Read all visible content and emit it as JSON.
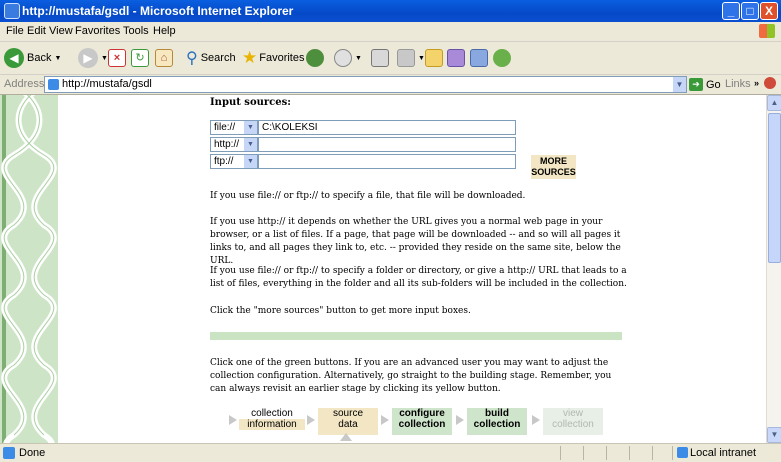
{
  "window": {
    "title": "http://mustafa/gsdl - Microsoft Internet Explorer",
    "controls": {
      "minimize": "_",
      "maximize": "□",
      "close": "X"
    }
  },
  "menu": [
    "File",
    "Edit",
    "View",
    "Favorites",
    "Tools",
    "Help"
  ],
  "toolbar": {
    "back": "Back",
    "search": "Search",
    "favorites": "Favorites"
  },
  "address": {
    "label": "Address",
    "url": "http://mustafa/gsdl",
    "go": "Go",
    "links": "Links"
  },
  "page": {
    "heading": "Input sources:",
    "sources": [
      {
        "protocol": "file://",
        "value": "C:\\KOLEKSI"
      },
      {
        "protocol": "http://",
        "value": ""
      },
      {
        "protocol": "ftp://",
        "value": ""
      }
    ],
    "more_sources": {
      "line1": "MORE",
      "line2": "SOURCES"
    },
    "paragraphs": [
      "If you use file:// or ftp:// to specify a file, that file will be downloaded.",
      "If you use http:// it depends on whether the URL gives you a normal web page in your browser, or a list of files. If a page, that page will be downloaded -- and so will all pages it links to, and all pages they link to, etc. -- provided they reside on the same site, below the URL.",
      "If you use file:// or ftp:// to specify a folder or directory, or give a http:// URL that leads to a list of files, everything in the folder and all its sub-folders will be included in the collection.",
      "Click the \"more sources\" button to get more input boxes."
    ],
    "instructions": "Click one of the green buttons. If you are an advanced user you may want to adjust the collection configuration. Alternatively, go straight to the building stage. Remember, you can always revisit an earlier stage by clicking its yellow button.",
    "stages": [
      {
        "line1": "collection",
        "line2": "information",
        "state": "visited"
      },
      {
        "line1": "source",
        "line2": "data",
        "state": "current"
      },
      {
        "line1": "configure",
        "line2": "collection",
        "state": "available"
      },
      {
        "line1": "build",
        "line2": "collection",
        "state": "available"
      },
      {
        "line1": "view",
        "line2": "collection",
        "state": "disabled"
      }
    ],
    "colors": {
      "visited": "#f2e6c4",
      "current": "#f2e6c4",
      "available": "#cfe5cb",
      "disabled": "#e8efe6",
      "vine": "#cde4c7"
    }
  },
  "status": {
    "text": "Done",
    "zone": "Local intranet"
  }
}
